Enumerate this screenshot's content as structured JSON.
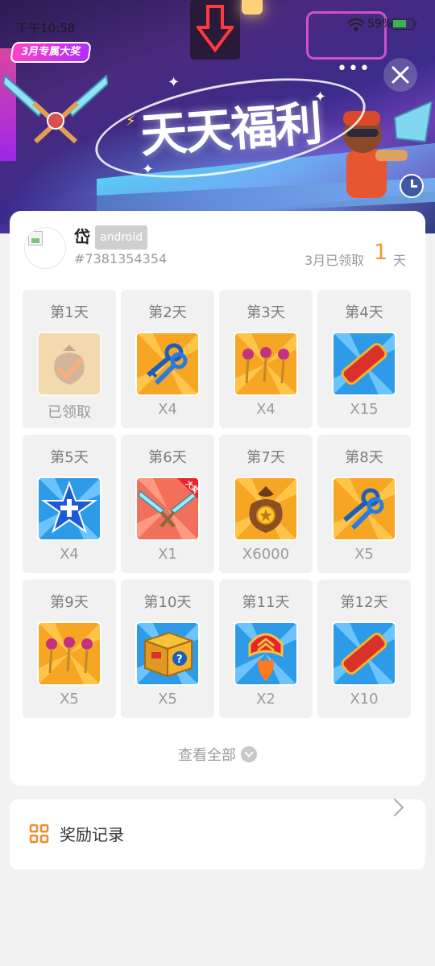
{
  "status_bar": {
    "time": "下午10:58",
    "battery": "59%"
  },
  "banner": {
    "promo_badge": "3月专属大奖",
    "title": "天天福利",
    "more_icon": "more-dots-icon",
    "close_icon": "close-icon"
  },
  "user": {
    "name": "岱",
    "platform": "android",
    "id": "#7381354354",
    "claimed_prefix": "3月已领取",
    "claimed_days": "1",
    "claimed_suffix": "天"
  },
  "rewards": [
    {
      "day": "第1天",
      "qty": "已领取",
      "icon": "coin-bag-claimed-icon"
    },
    {
      "day": "第2天",
      "qty": "X4",
      "icon": "keys-icon"
    },
    {
      "day": "第3天",
      "qty": "X4",
      "icon": "heart-keys-icon"
    },
    {
      "day": "第4天",
      "qty": "X15",
      "icon": "hoverboard-icon"
    },
    {
      "day": "第5天",
      "qty": "X4",
      "icon": "star-plus-icon"
    },
    {
      "day": "第6天",
      "qty": "X1",
      "icon": "weapon-icon",
      "badge": "大奖"
    },
    {
      "day": "第7天",
      "qty": "X6000",
      "icon": "coin-bag-icon"
    },
    {
      "day": "第8天",
      "qty": "X5",
      "icon": "keys-icon"
    },
    {
      "day": "第9天",
      "qty": "X5",
      "icon": "heart-keys-icon"
    },
    {
      "day": "第10天",
      "qty": "X5",
      "icon": "mystery-box-icon"
    },
    {
      "day": "第11天",
      "qty": "X2",
      "icon": "rocket-boost-icon"
    },
    {
      "day": "第12天",
      "qty": "X10",
      "icon": "hoverboard-icon"
    }
  ],
  "view_all": "查看全部",
  "records": {
    "label": "奖励记录",
    "icon": "grid-icon"
  },
  "colors": {
    "accent": "#f39a37",
    "cell_bg": "#f1f1f1",
    "promo": "#ff44c8"
  }
}
